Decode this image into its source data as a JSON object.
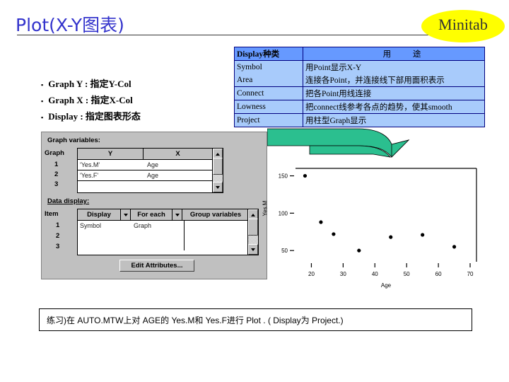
{
  "slide": {
    "title": "Plot(X-Y图表)",
    "logo_text": "Minitab",
    "accent_title_color": "#3333cc",
    "logo_color": "#ffff00",
    "table_header_color": "#6699ff",
    "table_body_color": "#a8cbfb",
    "arrow_color": "#2bbf8f"
  },
  "bullets": [
    {
      "mark": "▪",
      "text": "Graph Y : 指定Y-Col"
    },
    {
      "mark": "▪",
      "text": "Graph X : 指定X-Col"
    },
    {
      "mark": "▪",
      "text": "Display : 指定图表形态"
    }
  ],
  "display_table": {
    "headers": [
      "Display种类",
      "用      途"
    ],
    "rows": [
      {
        "kind": "Symbol",
        "use": "用Point显示X-Y"
      },
      {
        "kind": "Area",
        "use": "连接各Point，并连接线下部用面积表示"
      },
      {
        "kind": "Connect",
        "use": "把各Point用线连接"
      },
      {
        "kind": "Lowness",
        "use": "把connect线参考各点的趋势，使其smooth"
      },
      {
        "kind": "Project",
        "use": "用柱型Graph显示"
      }
    ]
  },
  "dialog": {
    "graph_variables_label": "Graph variables:",
    "graph_row_label": "Graph",
    "graph_columns": [
      "Y",
      "X"
    ],
    "graph_rows": [
      {
        "num": "1",
        "y": "'Yes.M'",
        "x": "Age"
      },
      {
        "num": "2",
        "y": "'Yes.F'",
        "x": "Age"
      },
      {
        "num": "3",
        "y": "",
        "x": ""
      }
    ],
    "data_display_label": "Data display:",
    "item_label": "Item",
    "data_columns": [
      "Display",
      "For each",
      "Group variables"
    ],
    "data_rows": [
      {
        "num": "1",
        "display": "Symbol",
        "for_each": "Graph",
        "group": ""
      },
      {
        "num": "2",
        "display": "",
        "for_each": "",
        "group": ""
      },
      {
        "num": "3",
        "display": "",
        "for_each": "",
        "group": ""
      }
    ],
    "edit_attributes_button": "Edit Attributes..."
  },
  "chart_data": {
    "type": "scatter",
    "title": "",
    "xlabel": "Age",
    "ylabel": "Yes.M",
    "xlim": [
      15,
      72
    ],
    "ylim": [
      35,
      160
    ],
    "xticks": [
      20,
      30,
      40,
      50,
      60,
      70
    ],
    "xtick_labels": [
      "20",
      "30",
      "40",
      "50",
      "60",
      "70"
    ],
    "yticks": [
      50,
      100,
      150
    ],
    "ytick_labels": [
      "50",
      "100",
      "150"
    ],
    "grid": false,
    "legend": false,
    "series": [
      {
        "name": "Yes.M",
        "points": [
          {
            "x": 18,
            "y": 150
          },
          {
            "x": 23,
            "y": 88
          },
          {
            "x": 27,
            "y": 72
          },
          {
            "x": 35,
            "y": 50
          },
          {
            "x": 45,
            "y": 68
          },
          {
            "x": 55,
            "y": 71
          },
          {
            "x": 65,
            "y": 55
          }
        ]
      }
    ]
  },
  "caption": {
    "text": "练习)在 AUTO.MTW上对 AGE的 Yes.M和 Yes.F进行 Plot .  ( Display为 Project.)"
  }
}
